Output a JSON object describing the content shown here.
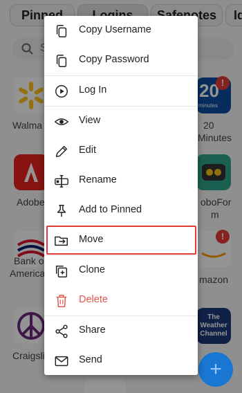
{
  "tabs": [
    {
      "label": "Pinned"
    },
    {
      "label": "Logins"
    },
    {
      "label": "Safenotes"
    },
    {
      "label": "Id"
    }
  ],
  "search": {
    "placeholder": "S"
  },
  "tiles": [
    {
      "label": "Walmart",
      "icon": "walmart-icon",
      "color": "#fdc220"
    },
    {
      "label": "20 Minutes",
      "icon": "20-minutes-icon",
      "color": "#0b4ea2"
    },
    {
      "label": "Adobe",
      "icon": "adobe-icon",
      "color": "#e8231e"
    },
    {
      "label": "RoboForm",
      "icon": "roboform-icon",
      "color": "#2fa68b"
    },
    {
      "label": "Bank of America",
      "icon": "bank-of-america-icon",
      "color": "#dc1431"
    },
    {
      "label": "Amazon",
      "icon": "amazon-icon",
      "color": "#232f3e"
    },
    {
      "label": "Craigslist",
      "icon": "peace-icon",
      "color": "#6b2a7a"
    },
    {
      "label": "The Weather Channel",
      "icon": "weather-channel-icon",
      "color": "#1a3a7a"
    }
  ],
  "bg_labels": {
    "walmart": "Walma",
    "twenty1": "20",
    "twenty2": "Minutes",
    "adobe": "Adobe",
    "robo1": "oboFor",
    "robo2": "m",
    "bank1": "Bank o",
    "bank2": "America",
    "amazon": "mazon",
    "craigslist": "Craigsli",
    "tile_20_top": "20",
    "tile_20_bottom": "minutes",
    "weather": "The Weather Channel"
  },
  "badges": {
    "alert": "!"
  },
  "fab": {
    "label": "+"
  },
  "menu": {
    "items": [
      {
        "label": "Copy Username",
        "icon": "copy-icon"
      },
      {
        "label": "Copy Password",
        "icon": "copy-icon"
      },
      {
        "label": "Log In",
        "icon": "play-circle-icon"
      },
      {
        "label": "View",
        "icon": "eye-icon"
      },
      {
        "label": "Edit",
        "icon": "pencil-icon"
      },
      {
        "label": "Rename",
        "icon": "rename-icon"
      },
      {
        "label": "Add to Pinned",
        "icon": "pin-icon"
      },
      {
        "label": "Move",
        "icon": "move-folder-icon"
      },
      {
        "label": "Clone",
        "icon": "clone-icon"
      },
      {
        "label": "Delete",
        "icon": "trash-icon"
      },
      {
        "label": "Share",
        "icon": "share-icon"
      },
      {
        "label": "Send",
        "icon": "envelope-icon"
      }
    ],
    "delete_color": "#e2574c",
    "highlight_color": "#e53935"
  }
}
